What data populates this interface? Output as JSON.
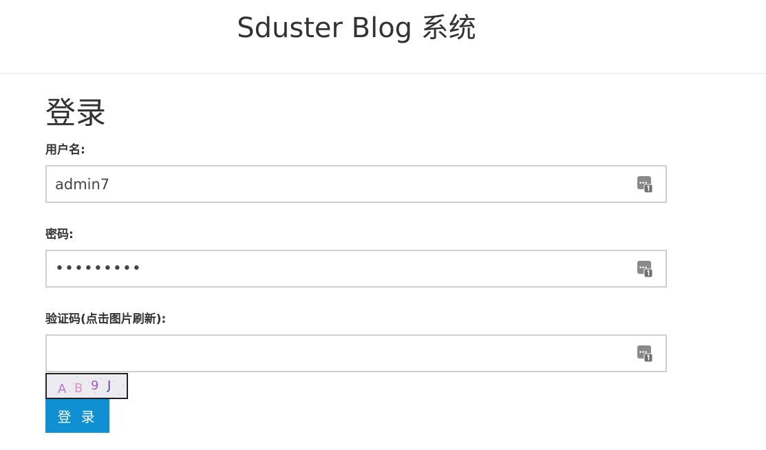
{
  "header": {
    "title": "Sduster Blog 系统"
  },
  "login": {
    "heading": "登录",
    "username": {
      "label": "用户名:",
      "value": "admin7"
    },
    "password": {
      "label": "密码:",
      "value": "•••••••••"
    },
    "captcha": {
      "label": "验证码(点击图片刷新):",
      "value": "",
      "image_text": "AB9J"
    },
    "submit_label": "登 录"
  },
  "colors": {
    "button_bg": "#0e90d2",
    "input_border": "#cfcfcf",
    "divider": "#e6e6e6"
  },
  "icons": {
    "password_manager": "password-manager-icon"
  }
}
